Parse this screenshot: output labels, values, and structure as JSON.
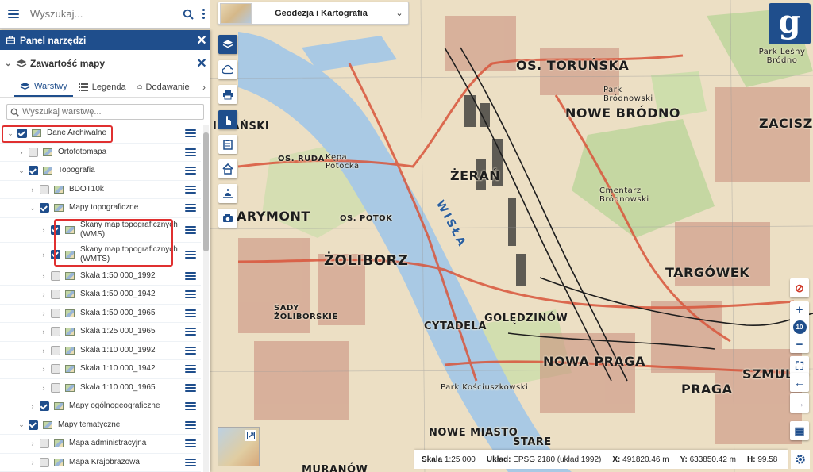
{
  "search": {
    "placeholder": "Wyszukaj..."
  },
  "panel": {
    "title": "Panel narzędzi",
    "content_title": "Zawartość mapy",
    "tabs": [
      {
        "label": "Warstwy",
        "active": true
      },
      {
        "label": "Legenda",
        "active": false
      },
      {
        "label": "Dodawanie",
        "active": false
      }
    ],
    "layer_search_placeholder": "Wyszukaj warstwę...",
    "layers": [
      {
        "label": "Dane Archiwalne",
        "checked": true,
        "expanded": true,
        "indent": 0,
        "highlight": true
      },
      {
        "label": "Ortofotomapa",
        "checked": false,
        "expanded": false,
        "indent": 1
      },
      {
        "label": "Topografia",
        "checked": true,
        "expanded": true,
        "indent": 1
      },
      {
        "label": "BDOT10k",
        "checked": false,
        "expanded": false,
        "indent": 2
      },
      {
        "label": "Mapy topograficzne",
        "checked": true,
        "expanded": true,
        "indent": 2
      },
      {
        "label": "Skany map topograficznych (WMS)",
        "checked": true,
        "expanded": false,
        "indent": 3,
        "tall": true,
        "highlight": true
      },
      {
        "label": "Skany map topograficznych (WMTS)",
        "checked": true,
        "expanded": false,
        "indent": 3,
        "tall": true,
        "highlight": true
      },
      {
        "label": "Skala 1:50 000_1992",
        "checked": false,
        "expanded": false,
        "indent": 3
      },
      {
        "label": "Skala 1:50 000_1942",
        "checked": false,
        "expanded": false,
        "indent": 3
      },
      {
        "label": "Skala 1:50 000_1965",
        "checked": false,
        "expanded": false,
        "indent": 3
      },
      {
        "label": "Skala 1:25 000_1965",
        "checked": false,
        "expanded": false,
        "indent": 3
      },
      {
        "label": "Skala 1:10 000_1992",
        "checked": false,
        "expanded": false,
        "indent": 3
      },
      {
        "label": "Skala 1:10 000_1942",
        "checked": false,
        "expanded": false,
        "indent": 3
      },
      {
        "label": "Skala 1:10 000_1965",
        "checked": false,
        "expanded": false,
        "indent": 3
      },
      {
        "label": "Mapy ogólnogeograficzne",
        "checked": true,
        "expanded": false,
        "indent": 2
      },
      {
        "label": "Mapy tematyczne",
        "checked": true,
        "expanded": true,
        "indent": 1
      },
      {
        "label": "Mapa administracyjna",
        "checked": false,
        "expanded": false,
        "indent": 2
      },
      {
        "label": "Mapa Krajobrazowa",
        "checked": false,
        "expanded": false,
        "indent": 2
      }
    ]
  },
  "basemap": {
    "label": "Geodezja i Kartografia"
  },
  "zoom": {
    "level": "10"
  },
  "logo": {
    "letter": "g"
  },
  "status": {
    "scale_label": "Skala",
    "scale_value": "1:25 000",
    "crs_label": "Układ:",
    "crs_value": "EPSG 2180 (układ 1992)",
    "x_label": "X:",
    "x_value": "491820.46 m",
    "y_label": "Y:",
    "y_value": "633850.42 m",
    "h_label": "H:",
    "h_value": "99.58"
  },
  "map_labels": {
    "torunska": "OS. TORUŃSKA",
    "nowe_brodno": "NOWE BRÓDNO",
    "zacisze": "ZACISZE",
    "park_lesny": "Park Leśny Bródno",
    "zeran": "ŻERAŃ",
    "wisla": "WISŁA",
    "marymont": "ARYMONT",
    "zoliborz": "ŻOLIBORZ",
    "targowek": "TARGÓWEK",
    "sady": "SADY ŻOLIBORSKIE",
    "golędzinow": "GOLĘDZINÓW",
    "nowa_praga": "NOWA PRAGA",
    "praga": "PRAGA",
    "szmulk": "SZMULK",
    "cytadela": "CYTADELA",
    "nowe_miasto": "NOWE MIASTO",
    "stare": "STARE",
    "os_potok": "OS. POTOK",
    "os_ruda": "OS. RUDA",
    "kepa": "Kępa Potocka",
    "bielanski": "IELAŃSKI",
    "park_brodnowski": "Park Bródnowski",
    "cmentarz": "Cmentarz Bródnowski",
    "park_praski": "Park Kościuszkowski",
    "muranow": "MURANÓW"
  }
}
